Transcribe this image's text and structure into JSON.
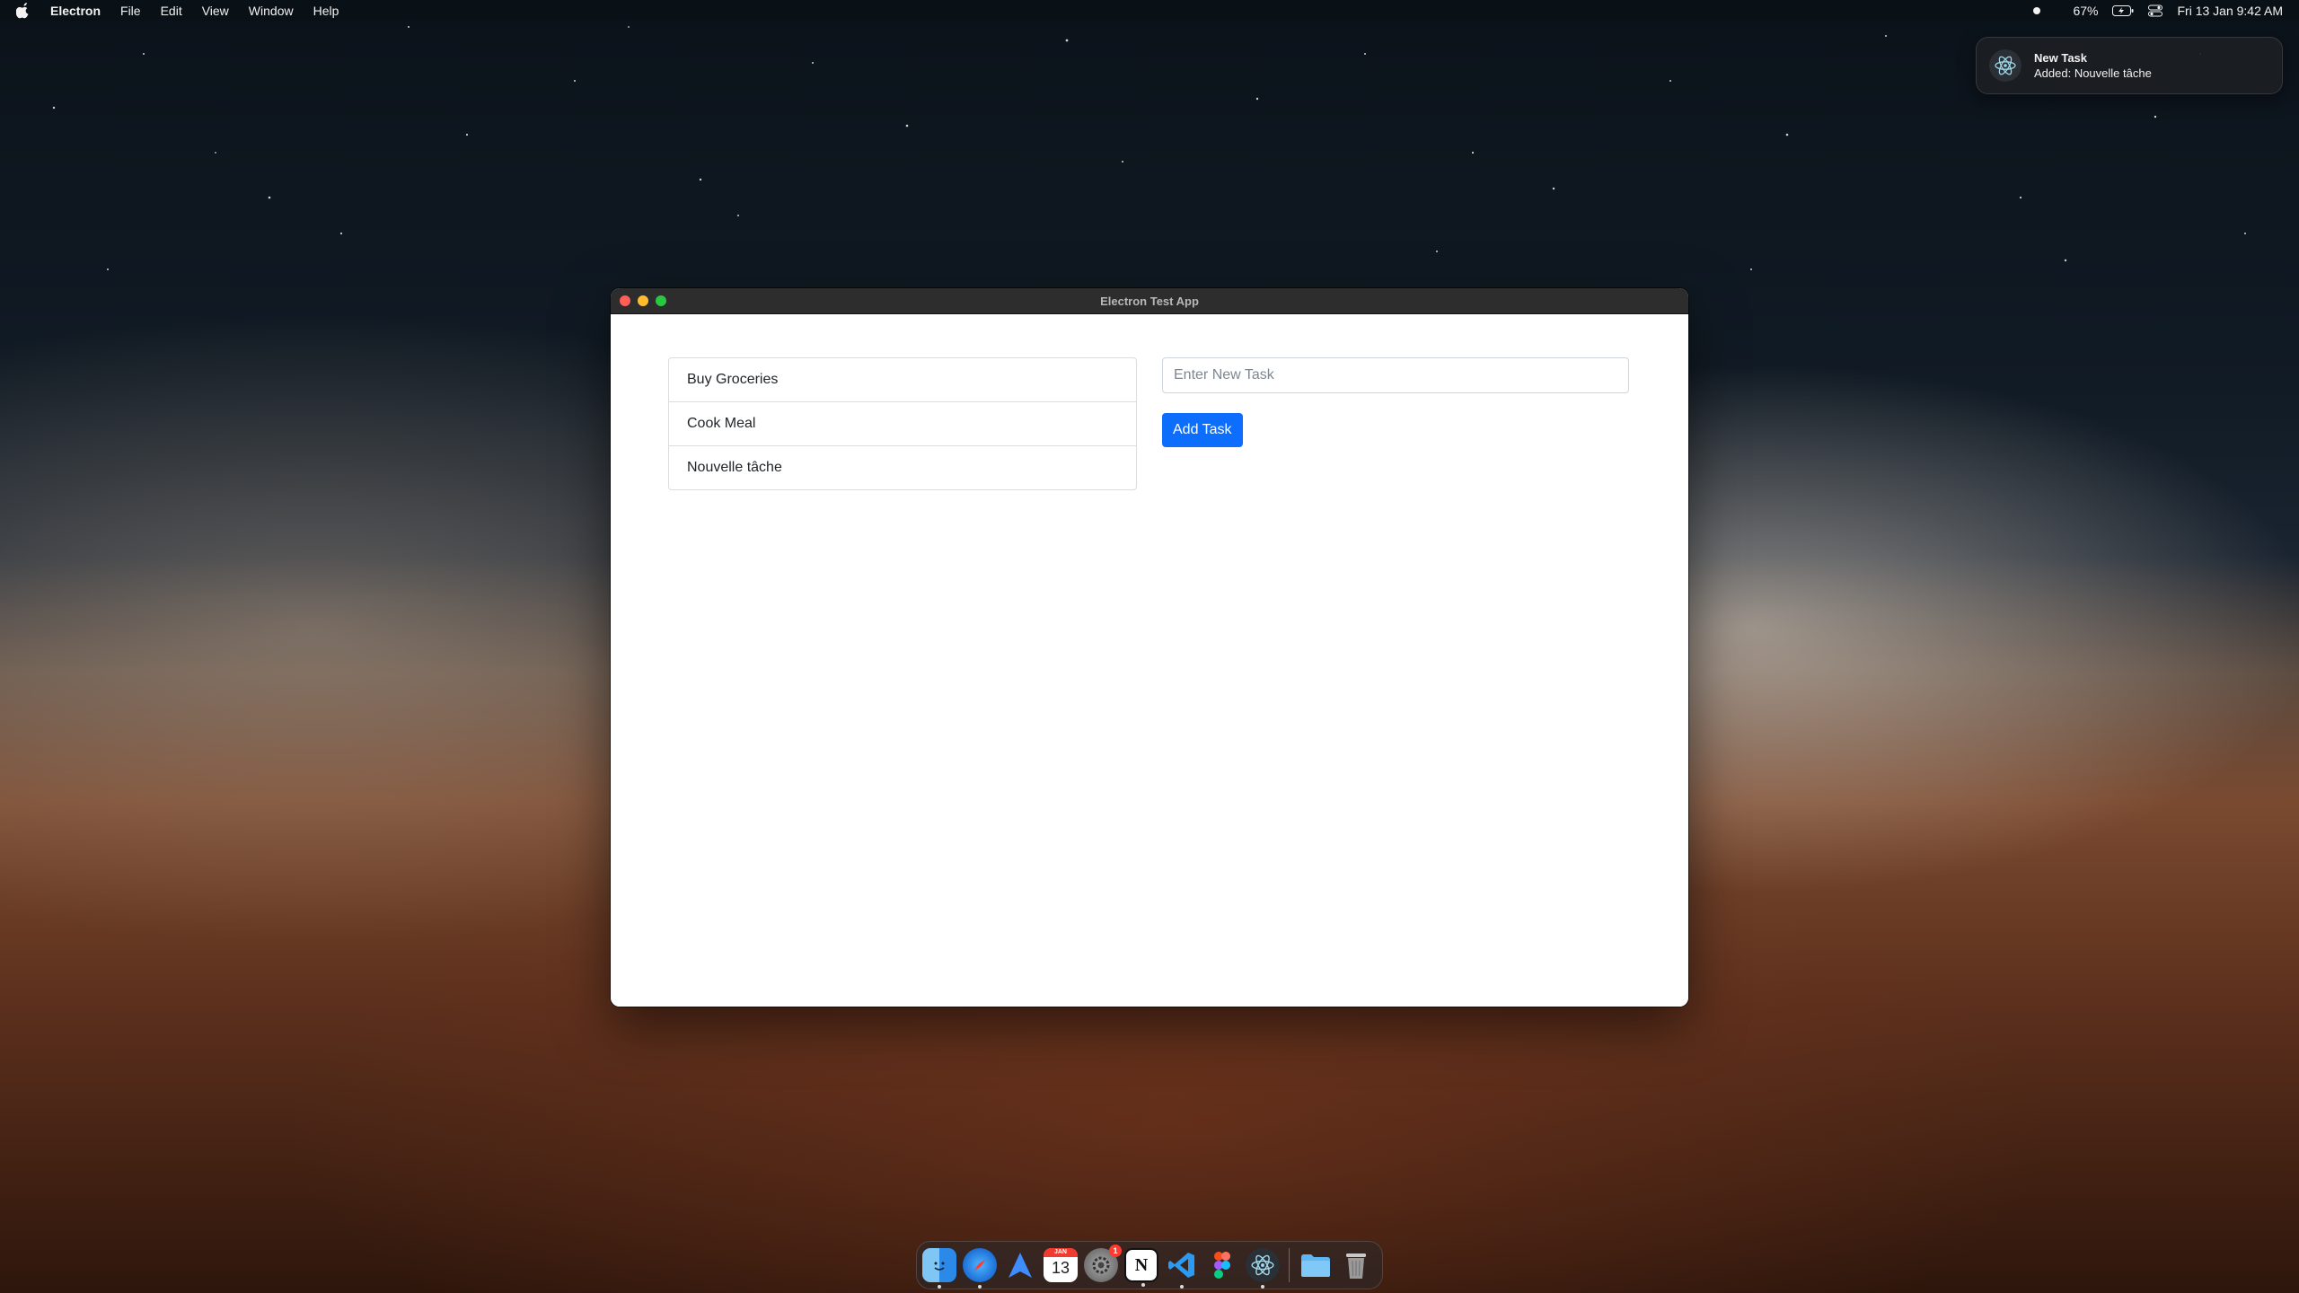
{
  "menubar": {
    "app_name": "Electron",
    "menus": [
      "File",
      "Edit",
      "View",
      "Window",
      "Help"
    ],
    "battery": "67%",
    "datetime": "Fri 13 Jan  9:42 AM"
  },
  "notification": {
    "title": "New Task",
    "body": "Added: Nouvelle tâche",
    "icon": "electron-icon"
  },
  "window": {
    "title": "Electron Test App",
    "tasks": [
      "Buy Groceries",
      "Cook Meal",
      "Nouvelle tâche"
    ],
    "input": {
      "value": "",
      "placeholder": "Enter New Task"
    },
    "add_button_label": "Add Task"
  },
  "dock": {
    "items": [
      {
        "name": "finder-icon",
        "running": true
      },
      {
        "name": "safari-icon",
        "running": true
      },
      {
        "name": "arrow-app-icon",
        "running": false
      },
      {
        "name": "calendar-icon",
        "label": "13",
        "month": "JAN",
        "running": false
      },
      {
        "name": "system-settings-icon",
        "badge": "1",
        "running": false
      },
      {
        "name": "notion-icon",
        "label": "N",
        "running": true
      },
      {
        "name": "vscode-icon",
        "running": true
      },
      {
        "name": "figma-icon",
        "running": false
      },
      {
        "name": "electron-icon",
        "running": true
      },
      {
        "name": "folder-icon",
        "running": false
      },
      {
        "name": "trash-icon",
        "running": false
      }
    ]
  }
}
